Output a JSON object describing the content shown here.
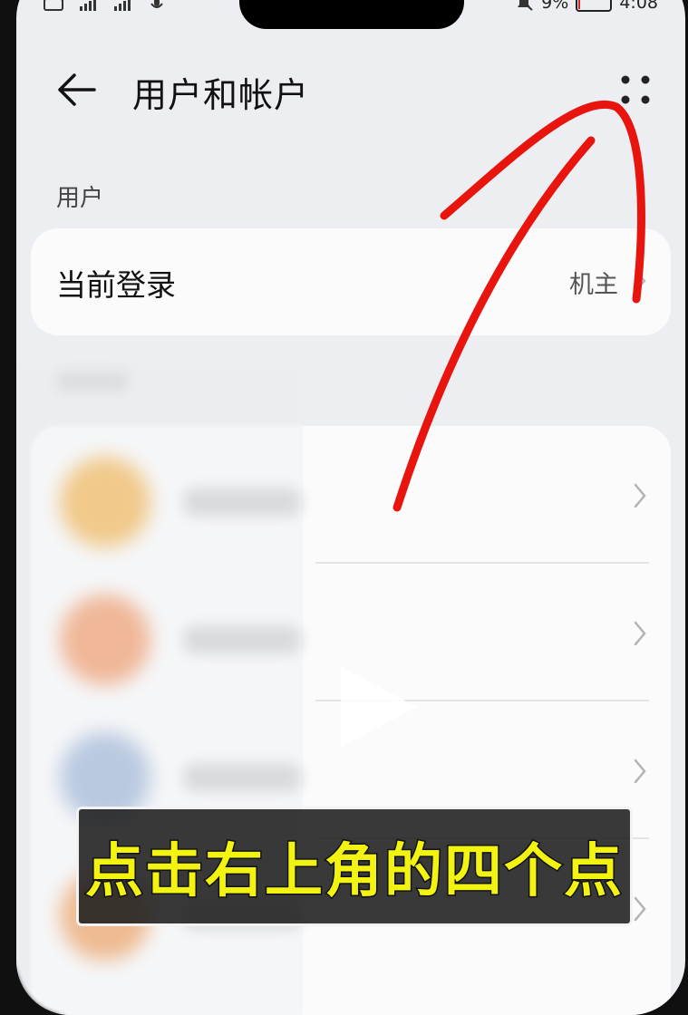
{
  "status_bar": {
    "battery": "9%",
    "time": "4:08"
  },
  "header": {
    "title": "用户和帐户"
  },
  "users": {
    "section_label": "用户",
    "current_login": {
      "label": "当前登录",
      "value": "机主"
    }
  },
  "caption": {
    "text": "点击右上角的四个点"
  },
  "colors": {
    "annotation": "#e8140e",
    "caption_text": "#f3f312",
    "caption_bg": "#1e1e1e"
  }
}
